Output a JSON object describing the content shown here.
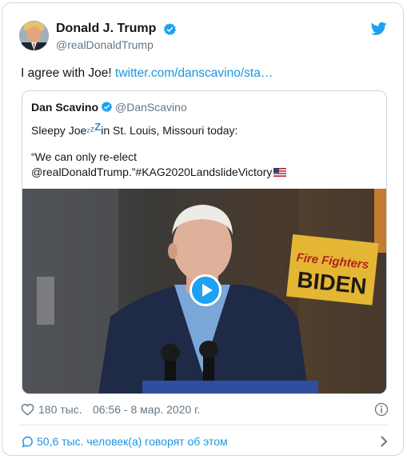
{
  "author": {
    "display_name": "Donald J. Trump",
    "handle": "@realDonaldTrump",
    "verified": true
  },
  "tweet": {
    "text": "I agree with Joe! ",
    "link": "twitter.com/danscavino/sta…"
  },
  "quoted": {
    "display_name": "Dan Scavino",
    "handle": "@DanScavino",
    "verified": true,
    "line1_before": "Sleepy Joe",
    "zzz_small": "z",
    "zzz_mid": "z",
    "zzz_big": "Z",
    "line1_after": "in St. Louis, Missouri today:",
    "line2": "“We can only re-elect",
    "line3": "@realDonaldTrump.”#KAG2020LandslideVictory",
    "sign_top": "Fire Fighters",
    "sign_bottom": "BIDEN"
  },
  "meta": {
    "likes": "180 тыс.",
    "timestamp": "06:56 - 8 мар. 2020 г."
  },
  "conversation": {
    "label": "50,6 тыс. человек(а) говорят об этом"
  },
  "colors": {
    "accent": "#1da1f2",
    "link": "#1b95e0",
    "muted": "#657786",
    "border": "#ccd6dd"
  },
  "icons": {
    "logo": "twitter-bird-icon",
    "verified": "verified-badge-icon",
    "like": "heart-icon",
    "info": "info-icon",
    "reply": "speech-bubble-icon",
    "more": "chevron-right-icon",
    "play": "play-icon"
  }
}
